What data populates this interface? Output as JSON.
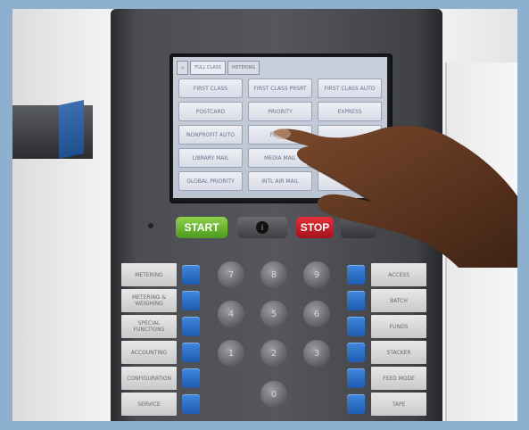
{
  "screen": {
    "tabs": [
      {
        "label": "FULL CLASS"
      },
      {
        "label": "METERING"
      }
    ],
    "services": [
      "FIRST CLASS",
      "FIRST CLASS PRSRT",
      "FIRST CLASS AUTO",
      "POSTCARD",
      "PRIORITY",
      "EXPRESS",
      "NONPROFIT AUTO",
      "PARCEL",
      "",
      "LIBRARY MAIL",
      "MEDIA MAIL",
      "",
      "GLOBAL PRIORITY",
      "INTL AIR MAIL",
      ""
    ]
  },
  "controls": {
    "start_label": "START",
    "info_label": "i",
    "stop_label": "STOP"
  },
  "left_keys": [
    "METERING",
    "METERING & WEIGHING",
    "SPECIAL FUNCTIONS",
    "ACCOUNTING",
    "CONFIGURATION",
    "SERVICE"
  ],
  "right_keys": [
    "ACCESS",
    "BATCH",
    "FUNDS",
    "STACKER",
    "FEED MODE",
    "TAPE"
  ],
  "numpad": [
    "7",
    "8",
    "9",
    "4",
    "5",
    "6",
    "1",
    "2",
    "3",
    "0"
  ],
  "colors": {
    "frame": "#8cb0cd",
    "start": "#6bbf2e",
    "stop": "#cc1f29",
    "blue_key": "#2f74c9"
  }
}
